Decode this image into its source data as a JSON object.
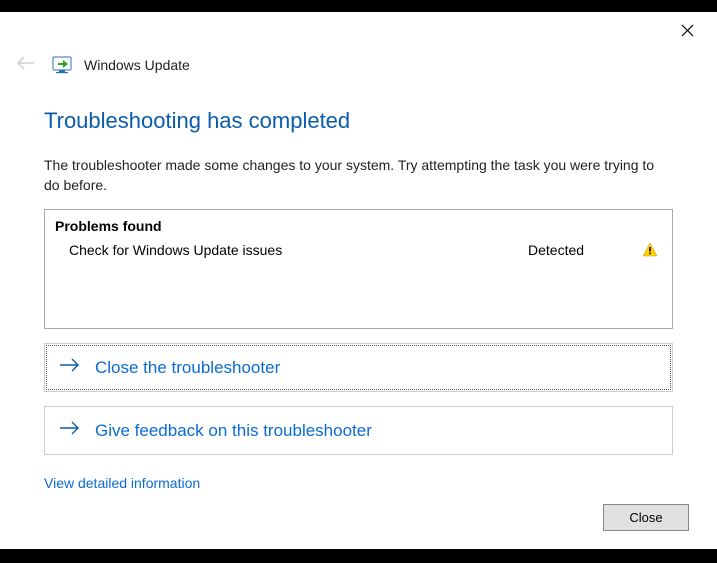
{
  "header": {
    "title": "Windows Update"
  },
  "page": {
    "heading": "Troubleshooting has completed",
    "description": "The troubleshooter made some changes to your system. Try attempting the task you were trying to do before."
  },
  "problems": {
    "title": "Problems found",
    "rows": [
      {
        "name": "Check for Windows Update issues",
        "status": "Detected"
      }
    ]
  },
  "actions": {
    "close_troubleshooter": "Close the troubleshooter",
    "give_feedback": "Give feedback on this troubleshooter",
    "view_detailed": "View detailed information"
  },
  "footer": {
    "close": "Close"
  }
}
